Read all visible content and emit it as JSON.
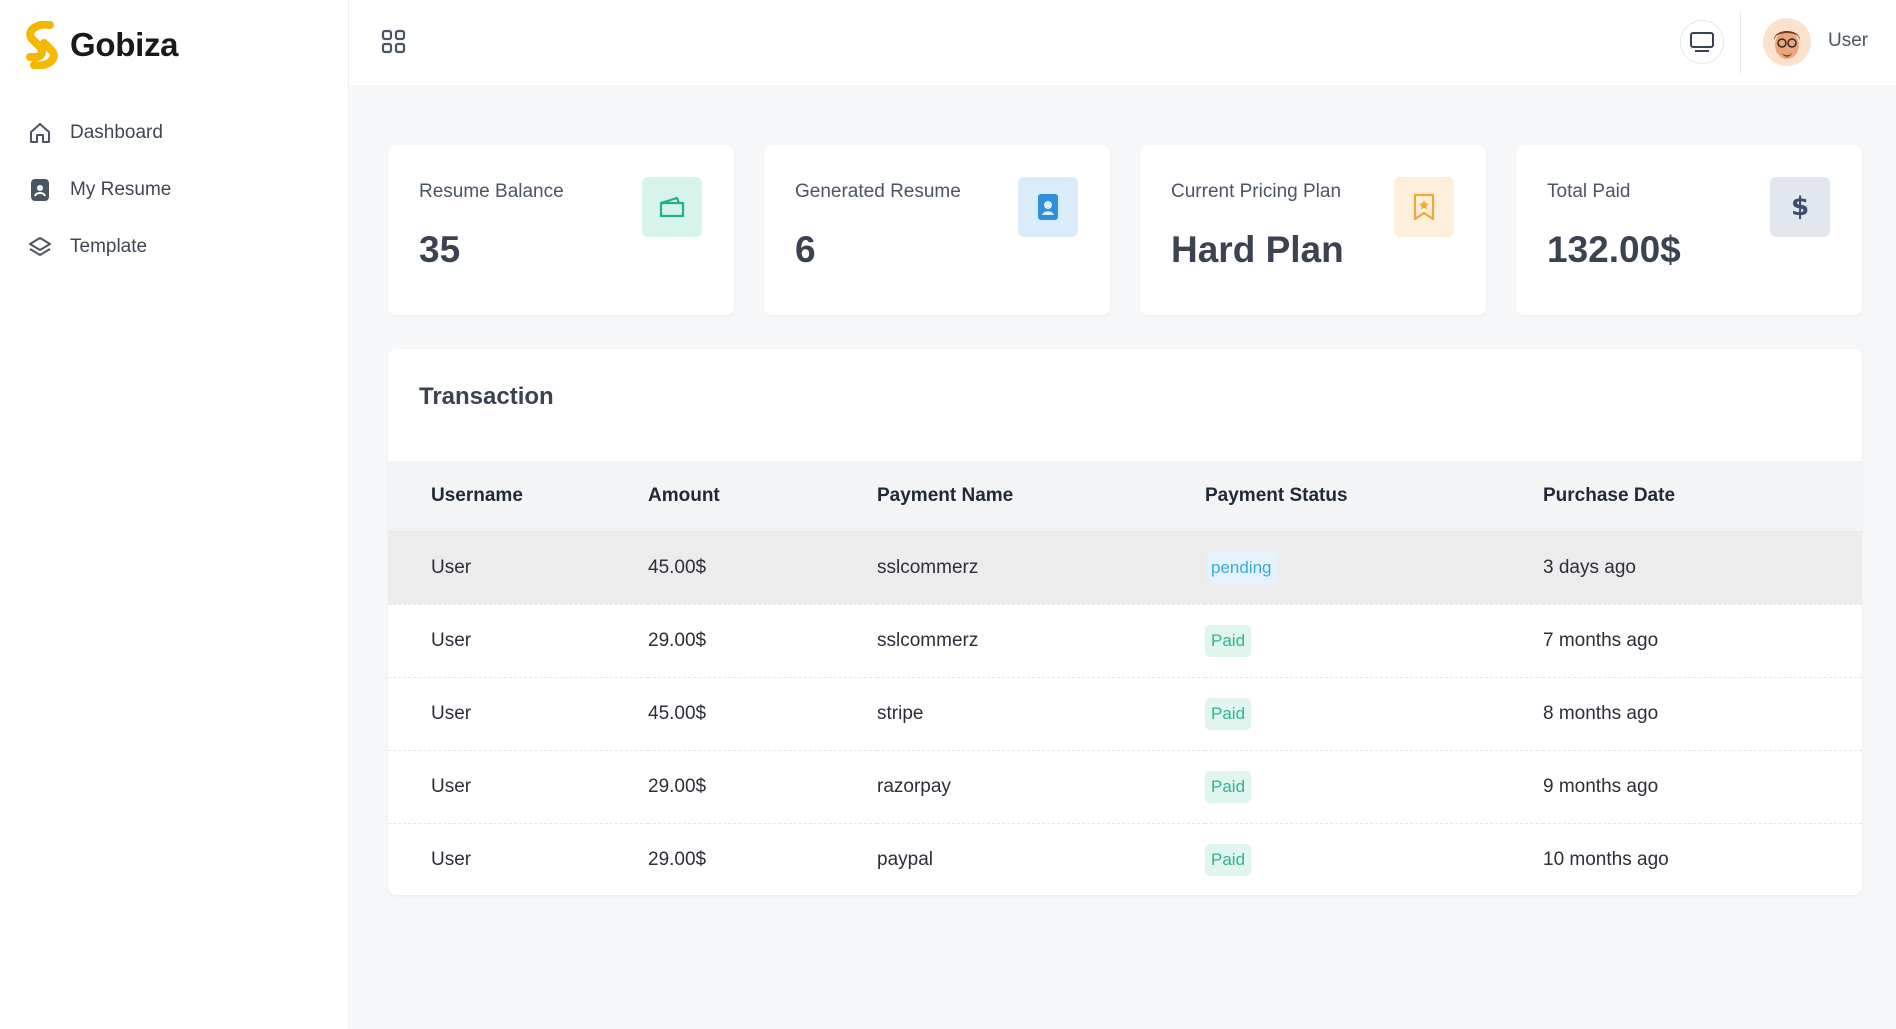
{
  "brand": {
    "name": "Gobiza",
    "accent": "#f5b800"
  },
  "sidebar": {
    "items": [
      {
        "label": "Dashboard",
        "icon": "home-icon"
      },
      {
        "label": "My Resume",
        "icon": "resume-icon"
      },
      {
        "label": "Template",
        "icon": "layers-icon"
      }
    ]
  },
  "topbar": {
    "menu_icon": "grid-icon",
    "screen_icon": "monitor-icon",
    "user_name": "User"
  },
  "stats": [
    {
      "title": "Resume Balance",
      "value": "35",
      "icon": "wallet-icon",
      "icon_bg": "#d6f3ec",
      "icon_color": "#20b089"
    },
    {
      "title": "Generated Resume",
      "value": "6",
      "icon": "contact-card-icon",
      "icon_bg": "#d8ecf9",
      "icon_color": "#2f8fd8"
    },
    {
      "title": "Current Pricing Plan",
      "value": "Hard Plan",
      "icon": "bookmark-star-icon",
      "icon_bg": "#fdefd9",
      "icon_color": "#f2a63a"
    },
    {
      "title": "Total Paid",
      "value": "132.00$",
      "icon": "dollar-icon",
      "icon_bg": "#e1e6ef",
      "icon_color": "#3e4c6e"
    }
  ],
  "transaction": {
    "title": "Transaction",
    "columns": [
      "Username",
      "Amount",
      "Payment Name",
      "Payment Status",
      "Purchase Date"
    ],
    "rows": [
      {
        "username": "User",
        "amount": "45.00$",
        "payment_name": "sslcommerz",
        "status": "pending",
        "date": "3 days ago"
      },
      {
        "username": "User",
        "amount": "29.00$",
        "payment_name": "sslcommerz",
        "status": "Paid",
        "date": "7 months ago"
      },
      {
        "username": "User",
        "amount": "45.00$",
        "payment_name": "stripe",
        "status": "Paid",
        "date": "8 months ago"
      },
      {
        "username": "User",
        "amount": "29.00$",
        "payment_name": "razorpay",
        "status": "Paid",
        "date": "9 months ago"
      },
      {
        "username": "User",
        "amount": "29.00$",
        "payment_name": "paypal",
        "status": "Paid",
        "date": "10 months ago"
      }
    ]
  }
}
